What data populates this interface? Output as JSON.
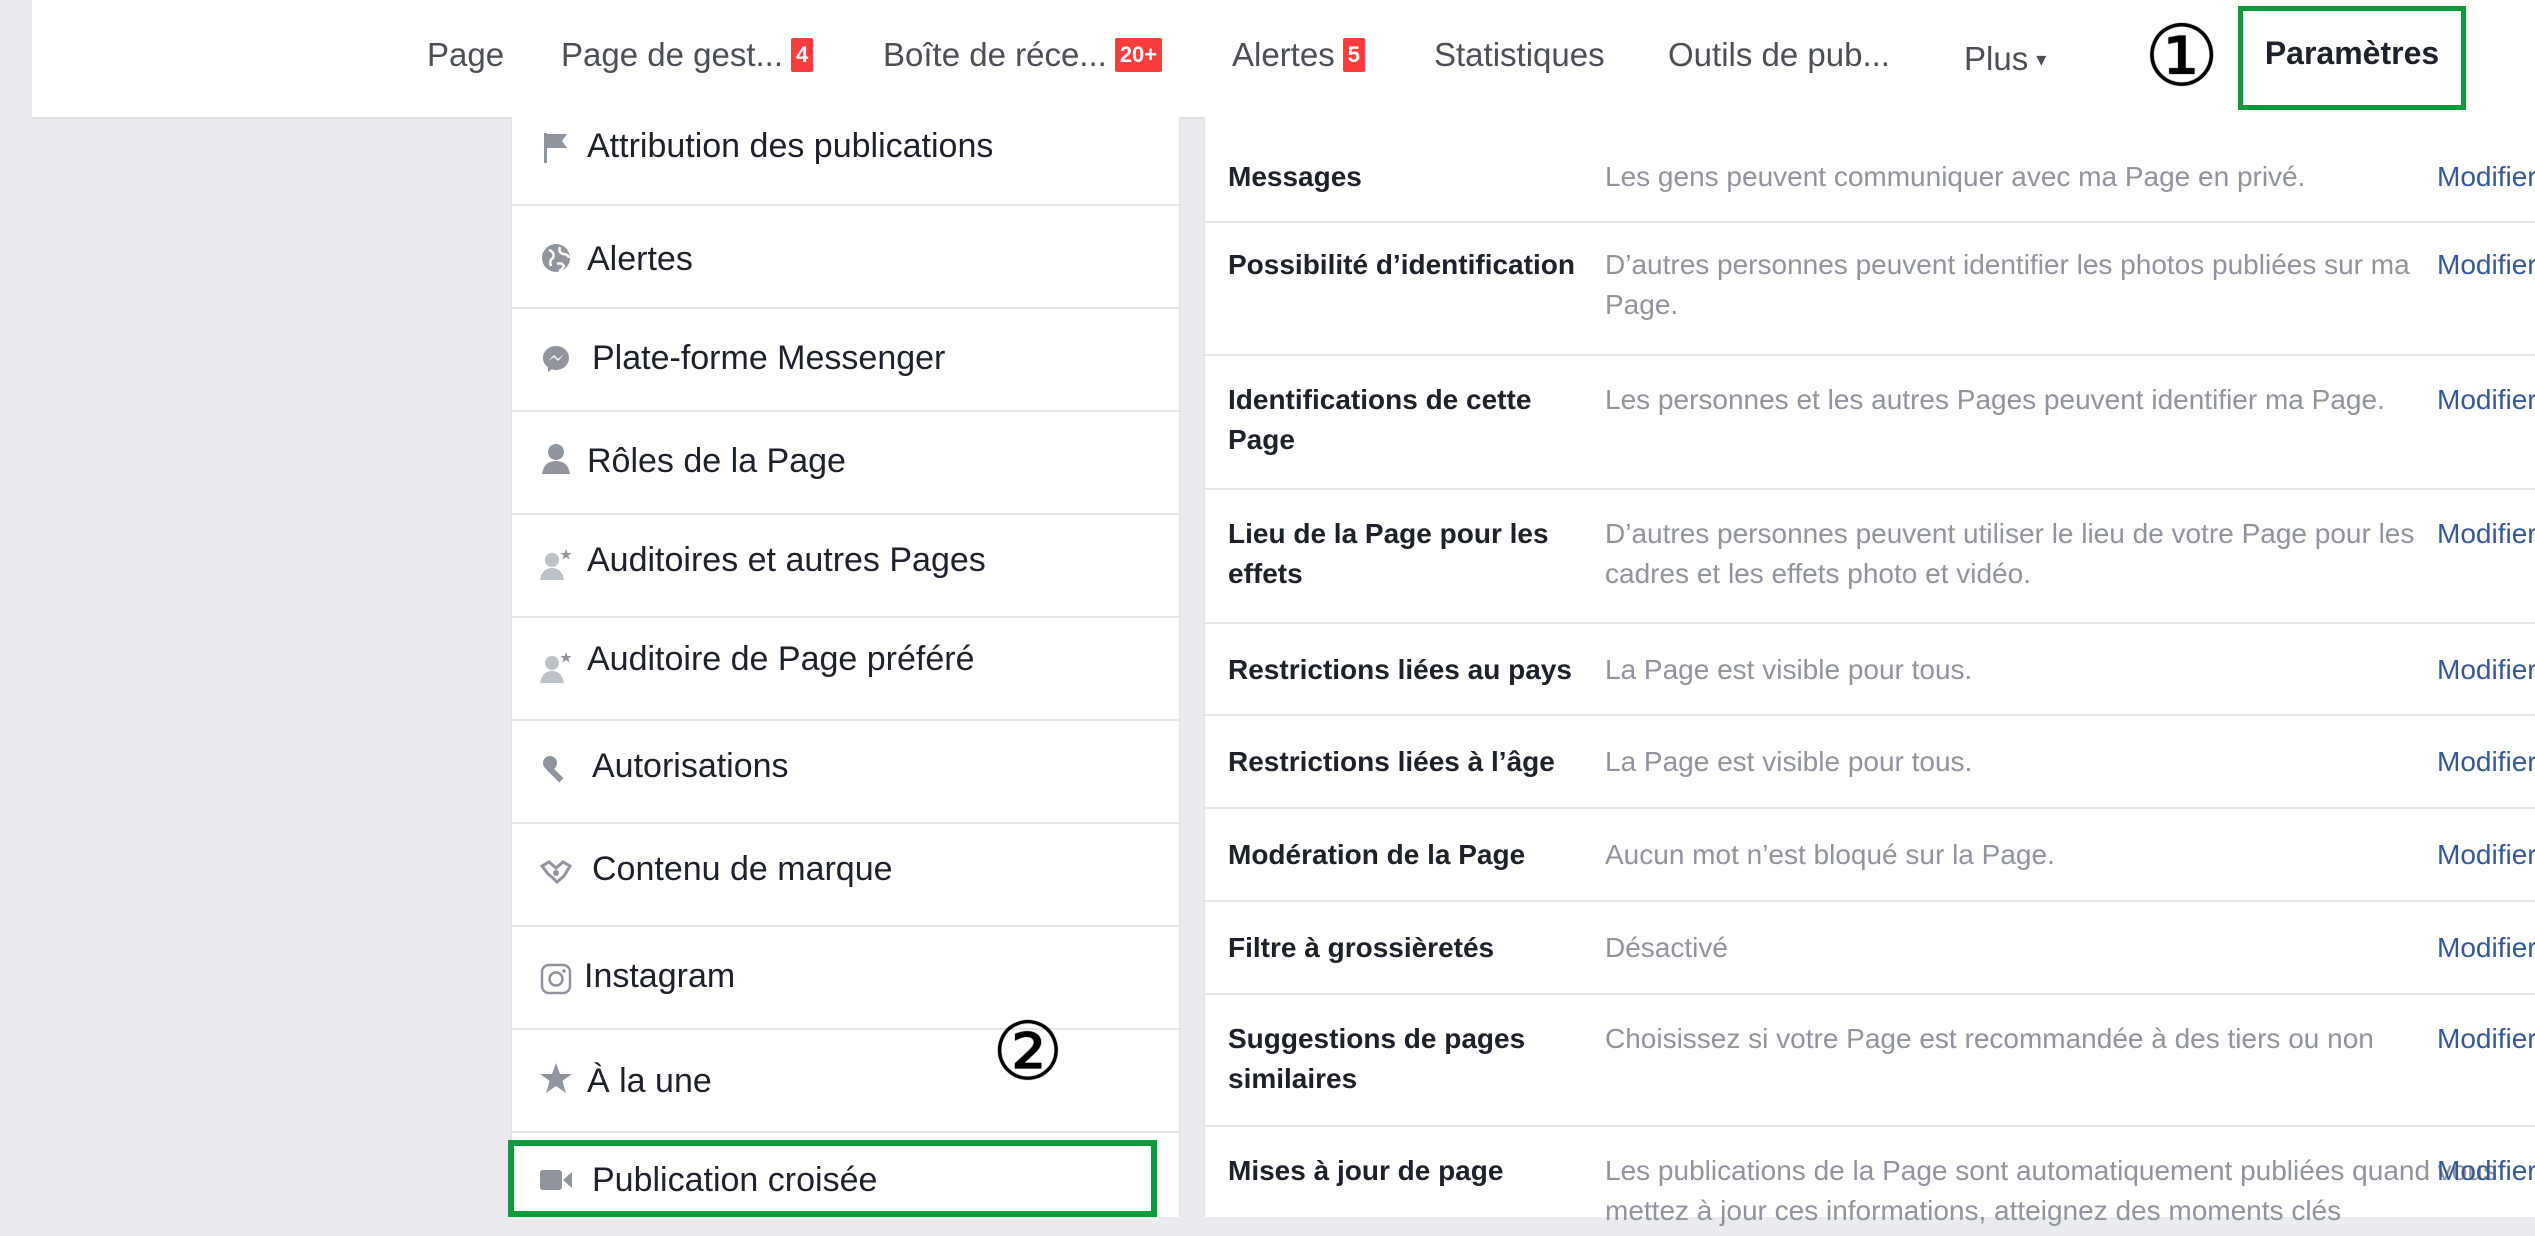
{
  "topnav": {
    "items": [
      {
        "label": "Page"
      },
      {
        "label": "Page de gest...",
        "badge": "4"
      },
      {
        "label": "Boîte de réce...",
        "badge": "20+"
      },
      {
        "label": "Alertes",
        "badge": "5"
      },
      {
        "label": "Statistiques"
      },
      {
        "label": "Outils de pub..."
      },
      {
        "label": "Plus"
      }
    ],
    "settings_label": "Paramètres",
    "step1": "①"
  },
  "sidebar": {
    "items": [
      {
        "label": "Attribution des publications",
        "icon": "flag-icon"
      },
      {
        "label": "Alertes",
        "icon": "globe-icon"
      },
      {
        "label": "Plate-forme Messenger",
        "icon": "messenger-icon"
      },
      {
        "label": "Rôles de la Page",
        "icon": "person-icon"
      },
      {
        "label": "Auditoires et autres Pages",
        "icon": "person-star-icon"
      },
      {
        "label": "Auditoire de Page préféré",
        "icon": "person-star-icon"
      },
      {
        "label": "Autorisations",
        "icon": "wrench-icon"
      },
      {
        "label": "Contenu de marque",
        "icon": "handshake-icon"
      },
      {
        "label": "Instagram",
        "icon": "instagram-icon"
      },
      {
        "label": "À la une",
        "icon": "star-icon"
      },
      {
        "label": "Publication croisée",
        "icon": "video-camera-icon"
      }
    ],
    "step2": "②"
  },
  "settings": {
    "link_label": "Modifier",
    "rows": [
      {
        "label": "Messages",
        "desc": "Les gens peuvent communiquer avec ma Page en privé."
      },
      {
        "label": "Possibilité d’identification",
        "desc": "D’autres personnes peuvent identifier les photos publiées sur ma Page."
      },
      {
        "label": "Identifications de cette Page",
        "desc": "Les personnes et les autres Pages peuvent identifier ma Page."
      },
      {
        "label": "Lieu de la Page pour les effets",
        "desc": "D’autres personnes peuvent utiliser le lieu de votre Page pour les cadres et les effets photo et vidéo."
      },
      {
        "label": "Restrictions liées au pays",
        "desc": "La Page est visible pour tous."
      },
      {
        "label": "Restrictions liées à l’âge",
        "desc": "La Page est visible pour tous."
      },
      {
        "label": "Modération de la Page",
        "desc": "Aucun mot n’est bloqué sur la Page."
      },
      {
        "label": "Filtre à grossièretés",
        "desc": "Désactivé"
      },
      {
        "label": "Suggestions de pages similaires",
        "desc": "Choisissez si votre Page est recommandée à des tiers ou non"
      },
      {
        "label": "Mises à jour de page",
        "desc": "Les publications de la Page sont automatiquement publiées quand vous mettez à jour ces informations, atteignez des moments clés"
      }
    ]
  },
  "colors": {
    "highlight": "#0c9a3a",
    "badge": "#fa3e3e",
    "link": "#365899"
  }
}
